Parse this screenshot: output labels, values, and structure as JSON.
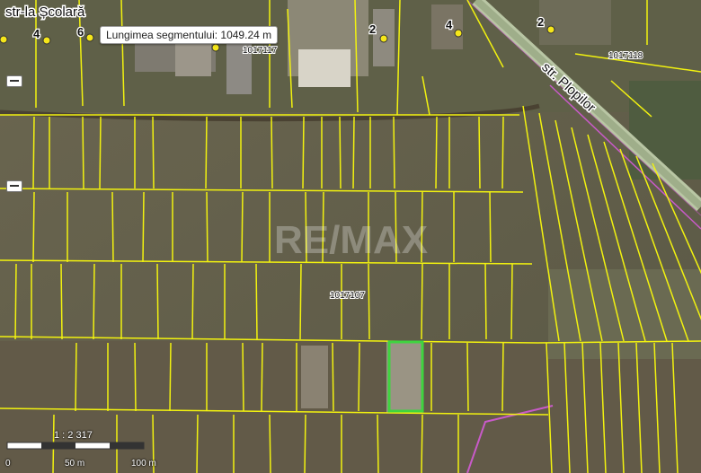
{
  "map": {
    "measure_tooltip": "Lungimea segmentului: 1049.24 m",
    "streets": [
      "str-la Școlară",
      "str. Plopilor"
    ],
    "cadastral_ids": [
      "1017117",
      "1017118",
      "1017107"
    ],
    "house_numbers": [
      "4",
      "6",
      "2",
      "4",
      "2"
    ],
    "watermark": "RE/MAX",
    "scale": {
      "ratio": "1 : 2 317",
      "labels": [
        "0",
        "50 m",
        "100 m"
      ]
    },
    "colors": {
      "parcel_line": "#f2f20f",
      "selected_parcel": "#3fd43f",
      "street_boundary": "#c85ac8",
      "point_marker": "#f5e61a"
    }
  },
  "controls": {
    "zoom_in_icon": "minus-icon",
    "zoom_out_icon": "minus-icon"
  }
}
